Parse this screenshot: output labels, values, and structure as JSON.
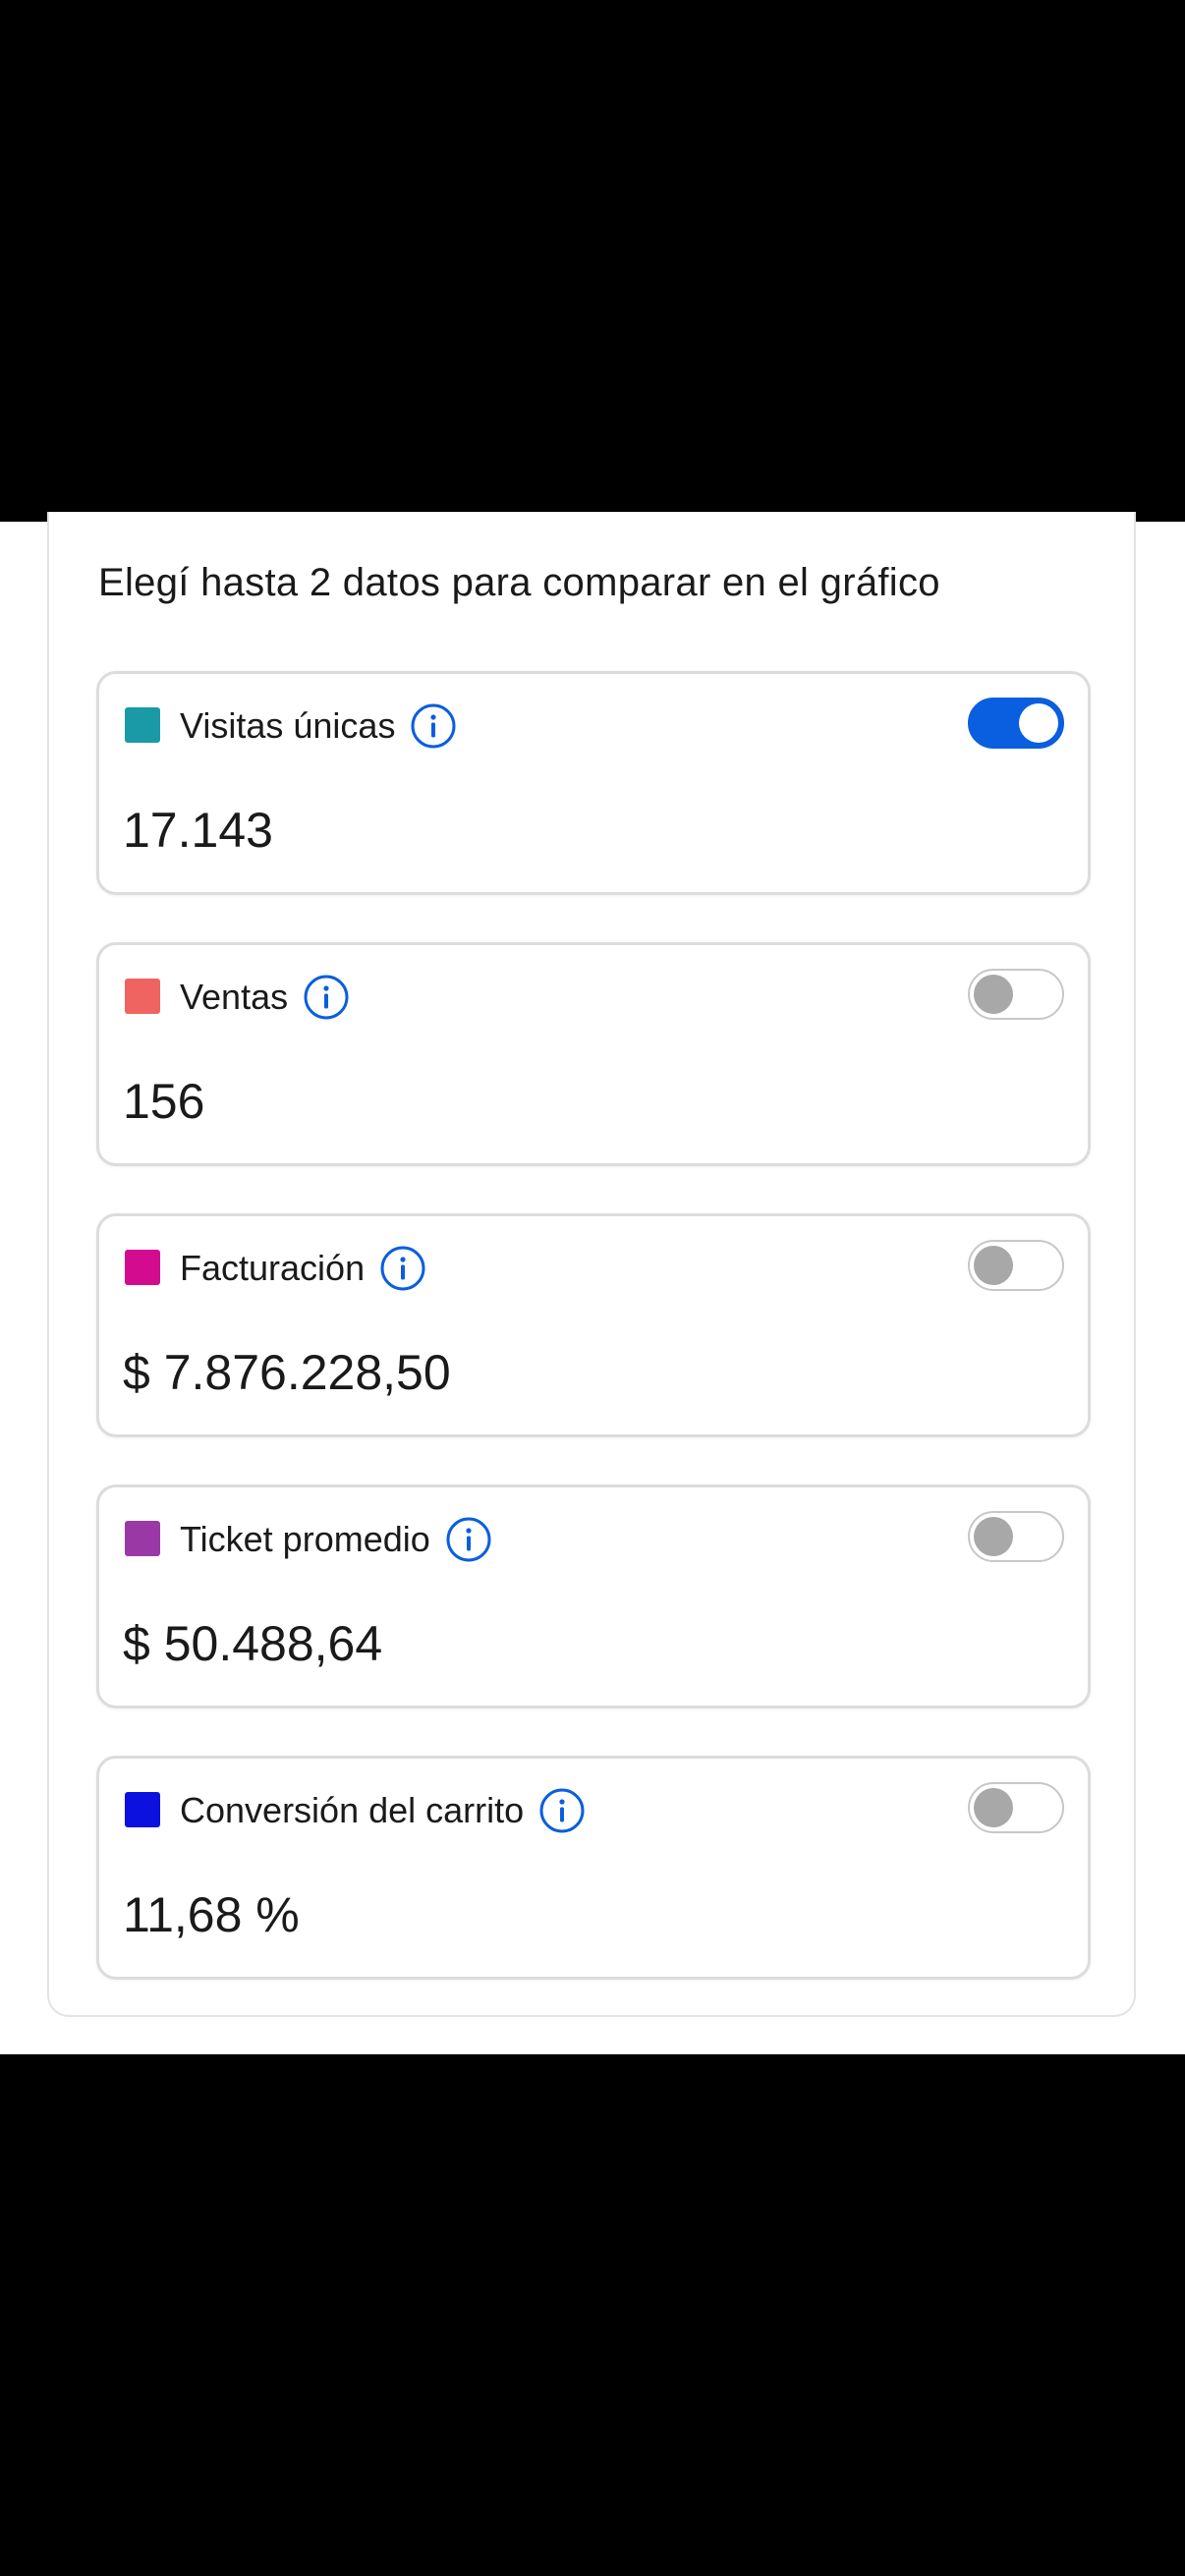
{
  "header": {
    "title": "Elegí hasta 2 datos para comparar en el gráfico"
  },
  "metrics": [
    {
      "label": "Visitas únicas",
      "value": "17.143",
      "color": "#1a9aa6",
      "enabled": true
    },
    {
      "label": "Ventas",
      "value": "156",
      "color": "#ef6461",
      "enabled": false
    },
    {
      "label": "Facturación",
      "value": "$ 7.876.228,50",
      "color": "#d30b8f",
      "enabled": false
    },
    {
      "label": "Ticket promedio",
      "value": "$ 50.488,64",
      "color": "#9a39a6",
      "enabled": false
    },
    {
      "label": "Conversión del carrito",
      "value": "11,68 %",
      "color": "#0d11e0",
      "enabled": false
    }
  ],
  "icons": {
    "info": "info-icon"
  },
  "colors": {
    "toggle_on": "#0a5ee0",
    "toggle_off_knob": "#a8a8a8",
    "info_icon": "#0a5ee0"
  }
}
